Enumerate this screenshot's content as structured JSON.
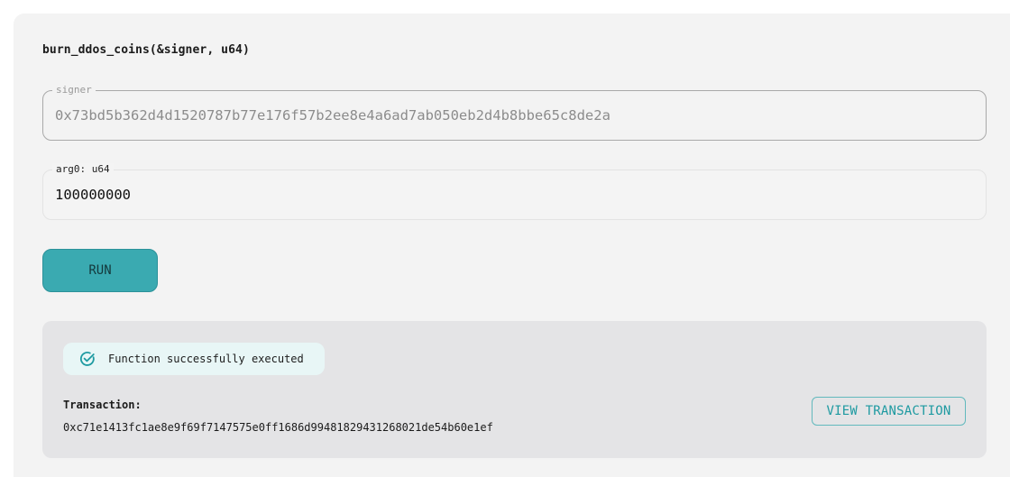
{
  "function": {
    "signature": "burn_ddos_coins(&signer, u64)"
  },
  "inputs": {
    "signer": {
      "label": "signer",
      "value": "0x73bd5b362d4d1520787b77e176f57b2ee8e4a6ad7ab050eb2d4b8bbe65c8de2a"
    },
    "arg0": {
      "label": "arg0: u64",
      "value": "100000000"
    }
  },
  "actions": {
    "run_label": "RUN"
  },
  "result": {
    "status_icon": "check-circle-icon",
    "status_text": "Function successfully executed",
    "transaction_label": "Transaction:",
    "transaction_hash": "0xc71e1413fc1ae8e9f69f7147575e0ff1686d99481829431268021de54b60e1ef",
    "view_button_label": "VIEW TRANSACTION"
  },
  "colors": {
    "accent": "#3aaab1",
    "accent_text": "#1e9aa1",
    "success_bg": "#e8f6f6",
    "panel_bg": "#e4e4e6"
  }
}
